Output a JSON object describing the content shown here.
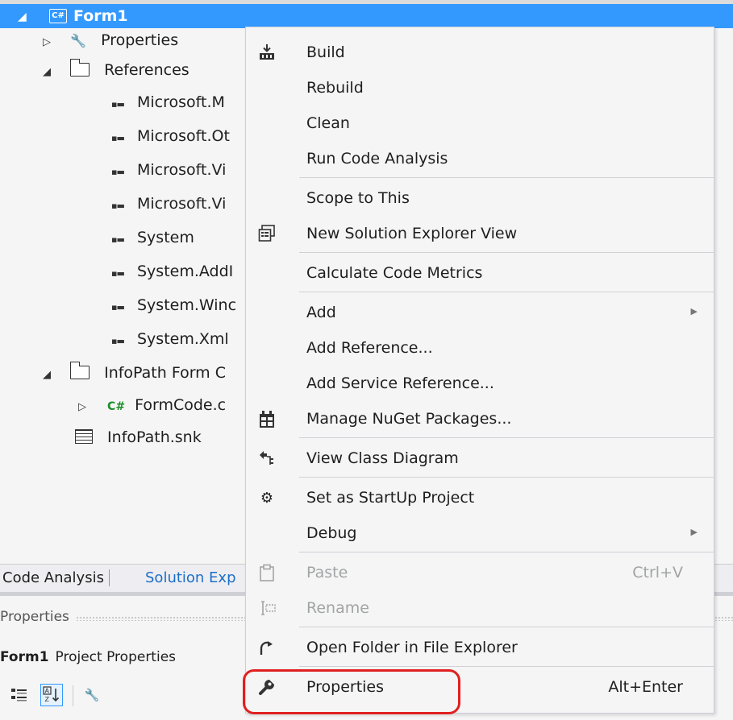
{
  "tree": {
    "root_label": "Form1",
    "root_icon": "csharp-project-icon",
    "nodes": [
      {
        "label": "Properties",
        "icon": "wrench-icon"
      },
      {
        "label": "References",
        "icon": "folder-icon"
      },
      {
        "label": "Microsoft.M",
        "icon": "reference-icon"
      },
      {
        "label": "Microsoft.Ot",
        "icon": "reference-icon"
      },
      {
        "label": "Microsoft.Vi",
        "icon": "reference-icon"
      },
      {
        "label": "Microsoft.Vi",
        "icon": "reference-icon"
      },
      {
        "label": "System",
        "icon": "reference-icon"
      },
      {
        "label": "System.AddI",
        "icon": "reference-icon"
      },
      {
        "label": "System.Winc",
        "icon": "reference-icon"
      },
      {
        "label": "System.Xml",
        "icon": "reference-icon"
      },
      {
        "label": "InfoPath Form C",
        "icon": "folder-icon"
      },
      {
        "label": "FormCode.c",
        "icon": "csharp-file-icon"
      },
      {
        "label": "InfoPath.snk",
        "icon": "key-file-icon"
      }
    ]
  },
  "bottom_tabs": [
    "Code Analysis",
    "Solution Exp"
  ],
  "properties_panel": {
    "title": "Properties",
    "object_name": "Form1",
    "object_type": "Project Properties"
  },
  "context_menu": {
    "items": [
      {
        "label": "Build",
        "icon": "build-icon"
      },
      {
        "label": "Rebuild"
      },
      {
        "label": "Clean"
      },
      {
        "label": "Run Code Analysis"
      },
      {
        "label": "Scope to This"
      },
      {
        "label": "New Solution Explorer View",
        "icon": "new-view-icon"
      },
      {
        "label": "Calculate Code Metrics"
      },
      {
        "label": "Add",
        "submenu": true
      },
      {
        "label": "Add Reference..."
      },
      {
        "label": "Add Service Reference..."
      },
      {
        "label": "Manage NuGet Packages...",
        "icon": "nuget-icon"
      },
      {
        "label": "View Class Diagram",
        "icon": "class-diagram-icon"
      },
      {
        "label": "Set as StartUp Project",
        "icon": "gear-icon"
      },
      {
        "label": "Debug",
        "submenu": true
      },
      {
        "label": "Paste",
        "icon": "paste-icon",
        "shortcut": "Ctrl+V",
        "disabled": true
      },
      {
        "label": "Rename",
        "icon": "rename-icon",
        "disabled": true
      },
      {
        "label": "Open Folder in File Explorer",
        "icon": "open-folder-icon"
      },
      {
        "label": "Properties",
        "icon": "wrench-icon",
        "shortcut": "Alt+Enter",
        "highlighted": true
      }
    ]
  },
  "colors": {
    "selection": "#3399ff",
    "highlight_ring": "#e02020",
    "menu_bg": "#f5f5f5",
    "disabled_text": "#a2a4a5",
    "tab_active": "#1c6fc7"
  }
}
